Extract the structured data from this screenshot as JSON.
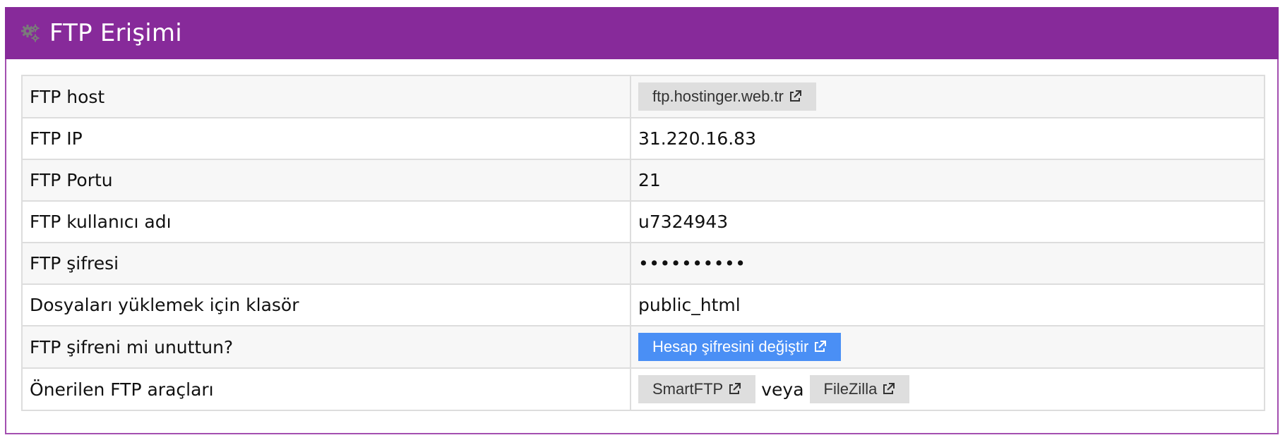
{
  "panel": {
    "title": "FTP Erişimi",
    "header_color": "#872a9a",
    "icon": "gears-icon"
  },
  "rows": [
    {
      "label": "FTP host",
      "value_type": "button",
      "button": {
        "label": "ftp.hostinger.web.tr",
        "icon": "external-link-icon"
      }
    },
    {
      "label": "FTP IP",
      "value": "31.220.16.83"
    },
    {
      "label": "FTP Portu",
      "value": "21"
    },
    {
      "label": "FTP kullanıcı adı",
      "value": "u7324943"
    },
    {
      "label": "FTP şifresi",
      "value": "••••••••••"
    },
    {
      "label": "Dosyaları yüklemek için klasör",
      "value": "public_html"
    },
    {
      "label": "FTP şifreni mi unuttun?",
      "value_type": "button",
      "button": {
        "label": "Hesap şifresini değiştir",
        "icon": "external-link-icon",
        "color": "#4a8ff5"
      }
    },
    {
      "label": "Önerilen FTP araçları",
      "value_type": "buttons",
      "buttons": [
        {
          "label": "SmartFTP",
          "icon": "external-link-icon"
        },
        {
          "label": "FileZilla",
          "icon": "external-link-icon"
        }
      ],
      "separator": "veya"
    }
  ]
}
